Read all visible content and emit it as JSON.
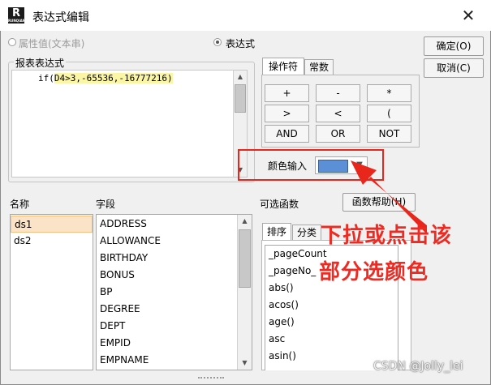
{
  "window": {
    "title": "表达式编辑",
    "close_glyph": "✕",
    "app_icon_letter": "R",
    "app_icon_caption": "RUNQIAN"
  },
  "radios": [
    {
      "label": "属性值(文本串)",
      "selected": false,
      "enabled": false
    },
    {
      "label": "表达式",
      "selected": true,
      "enabled": true
    }
  ],
  "buttons": {
    "ok": "确定(O)",
    "cancel": "取消(C)",
    "function_help": "函数帮助(H)"
  },
  "expression": {
    "label": "报表表达式",
    "text_prefix": "if(",
    "text_highlight": "D4>3,-65536,-16777216)"
  },
  "operator_tabs": [
    "操作符",
    "常数"
  ],
  "operators": [
    "+",
    "-",
    "*",
    ">",
    "<",
    "(",
    "AND",
    "OR",
    "NOT"
  ],
  "color_input": {
    "label": "颜色输入",
    "color": "#5b8fd6"
  },
  "name_list": {
    "header": "名称",
    "items": [
      "ds1",
      "ds2"
    ],
    "selected_index": 0
  },
  "field_list": {
    "header": "字段",
    "items": [
      "ADDRESS",
      "ALLOWANCE",
      "BIRTHDAY",
      "BONUS",
      "BP",
      "DEGREE",
      "DEPT",
      "EMPID",
      "EMPNAME"
    ]
  },
  "functions": {
    "header": "可选函数",
    "tabs": [
      "排序",
      "分类"
    ],
    "items": [
      "_pageCount",
      "_pageNo_",
      "abs()",
      "acos()",
      "age()",
      "asc",
      "asin()"
    ]
  },
  "annotation": {
    "line1": "下拉或点击该",
    "line2": "部分选颜色",
    "color": "#e8261b"
  },
  "watermark": "CSDN @Jolly_lei",
  "icons": {
    "close": "close-icon",
    "scroll_up": "scroll-up-arrow-icon",
    "scroll_down": "scroll-down-arrow-icon",
    "dropdown": "chevron-down-icon",
    "resize": "resize-grip-icon"
  }
}
